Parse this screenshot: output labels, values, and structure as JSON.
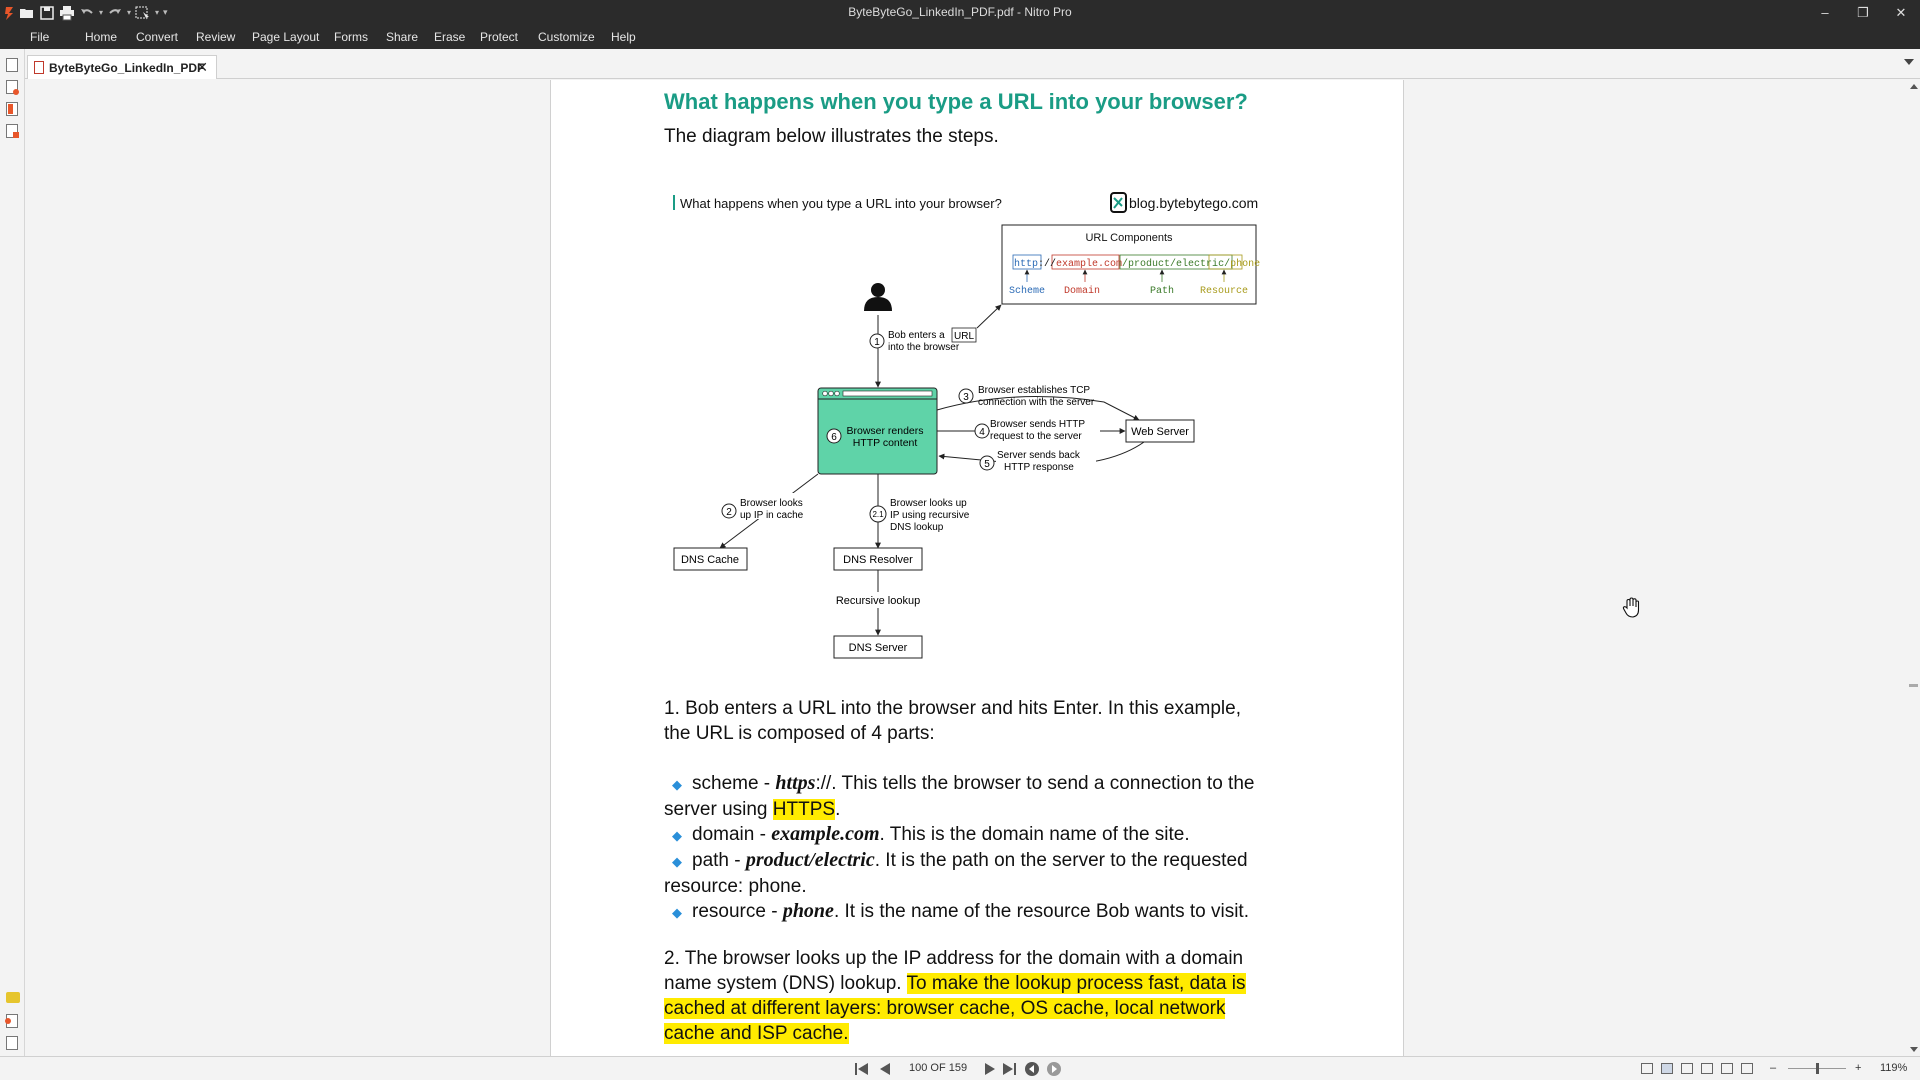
{
  "window": {
    "title": "ByteByteGo_LinkedIn_PDF.pdf - Nitro Pro",
    "controls": [
      "–",
      "❐",
      "✕"
    ]
  },
  "quick_access": [
    "nitro-logo",
    "open-icon",
    "save-icon",
    "print-icon",
    "undo-icon",
    "redo-icon",
    "select-tool-icon",
    "customize-icon"
  ],
  "menu": [
    "File",
    "Home",
    "Convert",
    "Review",
    "Page Layout",
    "Forms",
    "Share",
    "Erase",
    "Protect",
    "Customize",
    "Help"
  ],
  "tab": {
    "label": "ByteByteGo_LinkedIn_PDF",
    "close": "✕"
  },
  "document": {
    "heading": "What happens when you type a URL into your browser?",
    "subheading": "The diagram below illustrates the steps.",
    "diagram": {
      "header": "What happens when you type a URL into your browser?",
      "brand": "blog.bytebytego.com",
      "url_box_title": "URL Components",
      "url_scheme": "http",
      "url_sep1": "://",
      "url_domain": "example.com",
      "url_path": "/product/electric/",
      "url_resource": "phone",
      "label_scheme": "Scheme",
      "label_domain": "Domain",
      "label_path": "Path",
      "label_resource": "Resource",
      "step1_num": "1",
      "step1_a": "Bob enters a",
      "step1_url": "URL",
      "step1_b": "into the browser",
      "step3_num": "3",
      "step3_a": "Browser establishes TCP",
      "step3_b": "connection with the server",
      "step4_num": "4",
      "step4_a": "Browser sends HTTP",
      "step4_b": "request to the server",
      "step5_num": "5",
      "step5_a": "Server sends back",
      "step5_b": "HTTP response",
      "step6_num": "6",
      "step6_a": "Browser renders",
      "step6_b": "HTTP content",
      "step2_num": "2",
      "step2_a": "Browser looks",
      "step2_b": "up IP in cache",
      "step21_num": "2.1",
      "step21_a": "Browser looks up",
      "step21_b": "IP using recursive",
      "step21_c": "DNS lookup",
      "web_server": "Web Server",
      "dns_cache": "DNS Cache",
      "dns_resolver": "DNS Resolver",
      "recursive_lookup": "Recursive lookup",
      "dns_server": "DNS Server"
    },
    "p1_line1": "1. Bob enters a URL into the browser and hits Enter. In this example,",
    "p1_line2": "the URL is composed of 4 parts:",
    "b1_a": "scheme - ",
    "b1_b": "https",
    "b1_c": "://. This tells the browser to send a connection to the",
    "b1_d": "server using ",
    "b1_e": "HTTPS",
    "b1_f": ".",
    "b2_a": "domain - ",
    "b2_b": "example.com",
    "b2_c": ". This is the domain name of the site.",
    "b3_a": "path - ",
    "b3_b": "product/electric",
    "b3_c": ". It is the path on the server to the requested",
    "b3_d": "resource: phone.",
    "b4_a": "resource - ",
    "b4_b": "phone",
    "b4_c": ". It is the name of the resource Bob wants to visit.",
    "p2_line1": "2. The browser looks up the IP address for the domain with a domain",
    "p2_line2a": "name system (DNS) lookup. ",
    "p2_line2b": "To make the lookup process fast, data is",
    "p2_line3": "cached at different layers: browser cache, OS cache, local network",
    "p2_line4": "cache and ISP cache."
  },
  "status": {
    "page_indicator": "100 OF 159",
    "zoom": "119%",
    "zoom_minus": "–",
    "zoom_plus": "+"
  },
  "colors": {
    "accent_heading": "#1a9c85",
    "highlight": "#ffeb00",
    "browser_box": "#5fd3a8",
    "titlebar": "#2b2b2b"
  }
}
